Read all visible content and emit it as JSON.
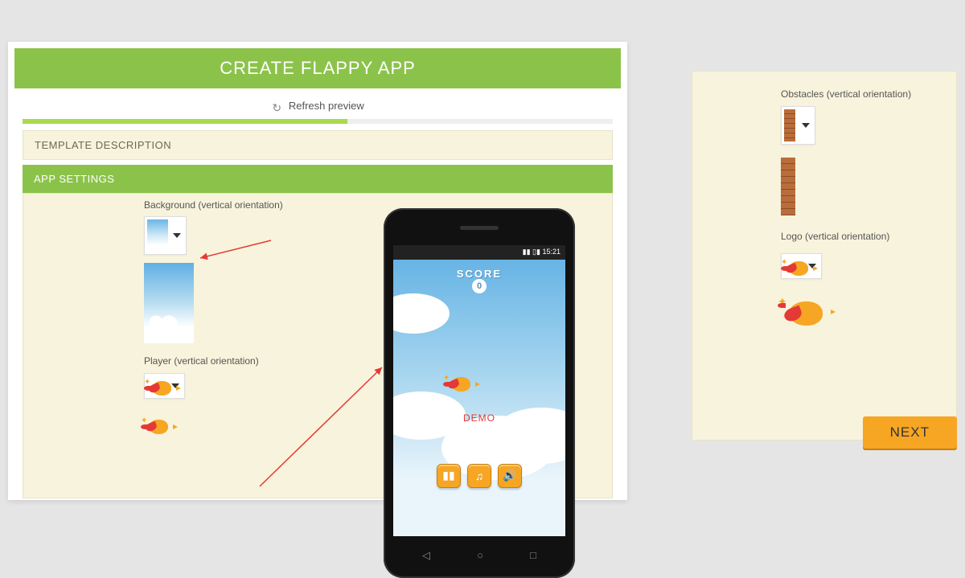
{
  "header": {
    "title": "CREATE FLAPPY APP"
  },
  "refresh": {
    "label": "Refresh preview"
  },
  "sections": {
    "description_label": "TEMPLATE DESCRIPTION",
    "settings_label": "APP SETTINGS"
  },
  "settings": {
    "background": {
      "label": "Background (vertical orientation)"
    },
    "player": {
      "label": "Player (vertical orientation)"
    },
    "obstacles": {
      "label": "Obstacles (vertical orientation)"
    },
    "logo": {
      "label": "Logo (vertical orientation)"
    }
  },
  "phone": {
    "status_time": "15:21",
    "score_label": "SCORE",
    "score_value": "0",
    "demo_label": "DEMO"
  },
  "buttons": {
    "next": "NEXT"
  },
  "progress": {
    "percent": 55
  },
  "colors": {
    "accent": "#8bc34a",
    "action": "#f6a623",
    "panel": "#f8f3dc"
  }
}
